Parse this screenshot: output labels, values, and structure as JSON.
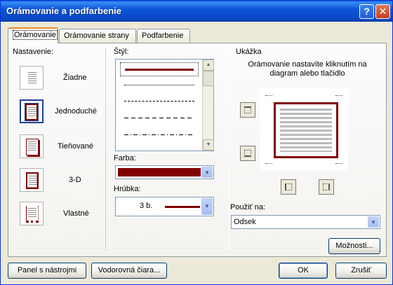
{
  "window": {
    "title": "Orámovanie a podfarbenie"
  },
  "tabs": [
    {
      "label": "Orámovanie",
      "active": true
    },
    {
      "label": "Orámovanie strany",
      "active": false
    },
    {
      "label": "Podfarbenie",
      "active": false
    }
  ],
  "settings": {
    "heading": "Nastavenie:",
    "items": [
      {
        "label": "Žiadne",
        "icon": "no-border-icon"
      },
      {
        "label": "Jednoduché",
        "icon": "box-border-icon"
      },
      {
        "label": "Tieňované",
        "icon": "shadow-border-icon"
      },
      {
        "label": "3-D",
        "icon": "3d-border-icon"
      },
      {
        "label": "Vlastné",
        "icon": "custom-border-icon"
      }
    ]
  },
  "style": {
    "heading": "Štýl:"
  },
  "color": {
    "heading": "Farba:",
    "value_color": "#800000"
  },
  "width": {
    "heading": "Hrúbka:",
    "value": "3 b."
  },
  "preview": {
    "heading": "Ukážka",
    "hint": "Orámovanie nastavíte kliknutím na diagram alebo tlačidlo"
  },
  "apply_to": {
    "heading": "Použiť na:",
    "value": "Odsek"
  },
  "buttons": {
    "options": "Možnosti...",
    "toolbar": "Panel s nástrojmi",
    "horizontal_line": "Vodorovná čiara...",
    "ok": "OK",
    "cancel": "Zrušiť"
  },
  "colors": {
    "accent": "#800000",
    "title_bar": "#0a55d6"
  }
}
